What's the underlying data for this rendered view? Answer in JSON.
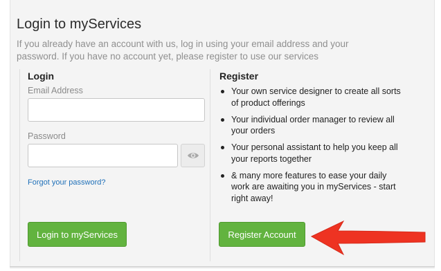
{
  "page": {
    "title": "Login to myServices",
    "intro": "If you already have an account with us, log in using your email address and your password. If you have no account yet, please register to use our services"
  },
  "login": {
    "heading": "Login",
    "email_label": "Email Address",
    "email_value": "",
    "password_label": "Password",
    "password_value": "",
    "show_password_icon": "eye-icon",
    "forgot_link": "Forgot your password?",
    "submit_label": "Login to myServices"
  },
  "register": {
    "heading": "Register",
    "features": [
      "Your own service designer to create all sorts of product offerings",
      "Your individual order manager to review all your orders",
      "Your personal assistant to help you keep all your reports together",
      "& many more features to ease your daily work are awaiting you in myServices - start right away!"
    ],
    "submit_label": "Register Account"
  },
  "annotation": {
    "arrow_icon": "red-arrow-left-icon",
    "arrow_color": "#ee3322"
  },
  "colors": {
    "button_green": "#62b33f",
    "link_blue": "#1e6fb8",
    "panel_bg": "#f4f4f4"
  }
}
